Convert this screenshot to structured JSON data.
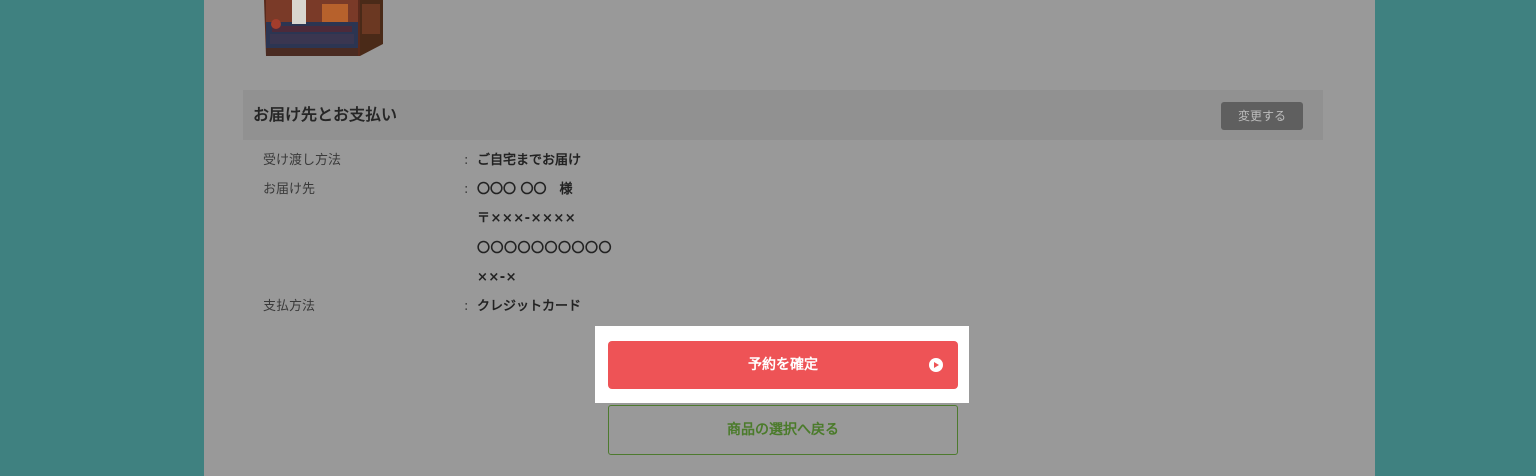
{
  "delivery_section": {
    "title": "お届け先とお支払い",
    "change_label": "変更する"
  },
  "details": {
    "handover": {
      "label": "受け渡し方法",
      "colon": ":",
      "value": "ご自宅までお届け"
    },
    "recipient": {
      "label": "お届け先",
      "colon": ":",
      "name": "〇〇〇 〇〇　様",
      "postal": "〒×××-××××",
      "address": "〇〇〇〇〇〇〇〇〇〇",
      "address2": "××-×"
    },
    "payment": {
      "label": "支払方法",
      "colon": ":",
      "value": "クレジットカード"
    }
  },
  "actions": {
    "confirm_label": "予約を確定",
    "back_label": "商品の選択へ戻る"
  },
  "colors": {
    "backdrop": "#3f8180",
    "panel_dimmed": "#999999",
    "confirm_red": "#ee5356",
    "back_green": "#4b7b2b"
  },
  "icons": {
    "confirm": "play-circle-icon"
  }
}
